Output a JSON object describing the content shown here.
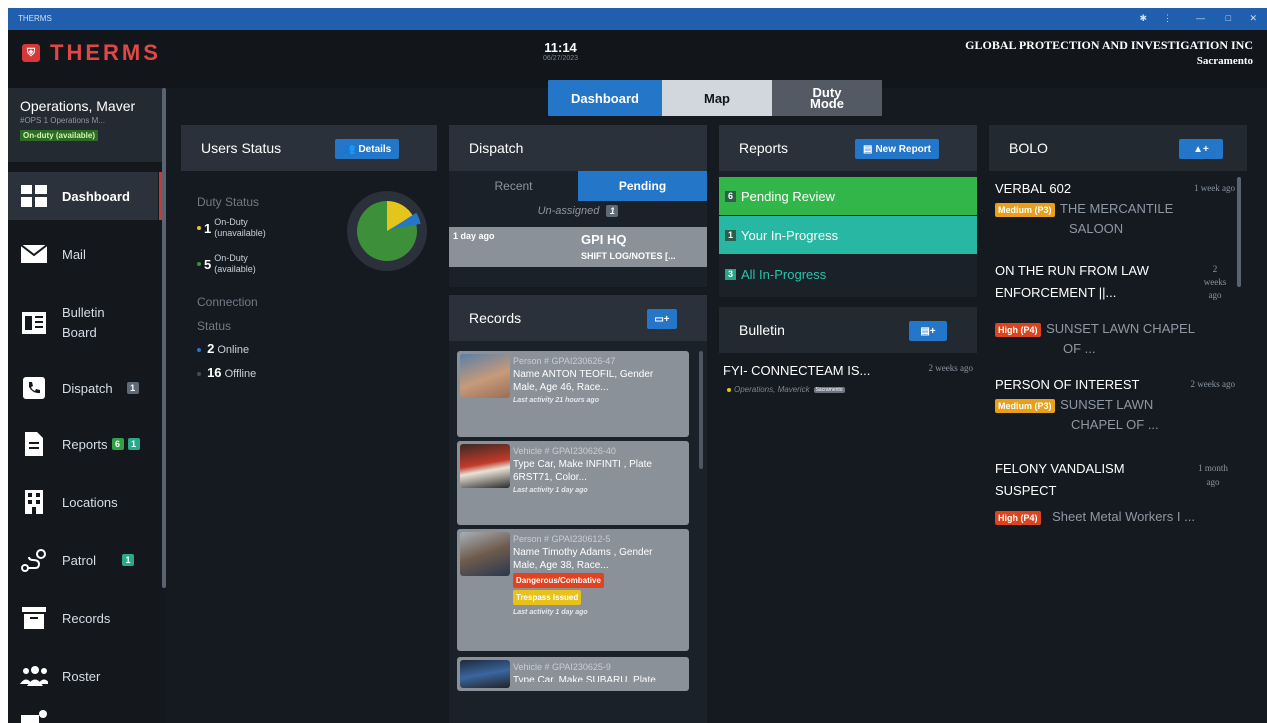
{
  "window": {
    "title": "THERMS"
  },
  "header": {
    "logo_text": "THERMS",
    "time": "11:14",
    "date": "06/27/2023",
    "company": "GLOBAL PROTECTION AND INVESTIGATION INC",
    "city": "Sacramento"
  },
  "profile": {
    "name": "Operations, Maver",
    "role": "#OPS 1 Operations M...",
    "status": "On-duty (available)"
  },
  "nav": [
    {
      "label": "Dashboard",
      "icon": "dashboard-icon"
    },
    {
      "label": "Mail",
      "icon": "mail-icon"
    },
    {
      "label": "Bulletin Board",
      "icon": "bulletin-board-icon"
    },
    {
      "label": "Dispatch",
      "icon": "dispatch-icon",
      "badge": "1"
    },
    {
      "label": "Reports",
      "icon": "reports-icon",
      "badge1": "6",
      "badge2": "1"
    },
    {
      "label": "Locations",
      "icon": "locations-icon"
    },
    {
      "label": "Patrol",
      "icon": "patrol-icon",
      "badge": "1"
    },
    {
      "label": "Records",
      "icon": "records-icon"
    },
    {
      "label": "Roster",
      "icon": "roster-icon"
    }
  ],
  "segments": {
    "dashboard": "Dashboard",
    "map": "Map",
    "duty1": "Duty",
    "duty2": "Mode"
  },
  "users_status": {
    "title": "Users Status",
    "details_button": "Details",
    "duty_status_label": "Duty Status",
    "on_duty_unavail_count": "1",
    "on_duty_unavail_l1": "On-Duty",
    "on_duty_unavail_l2": "(unavailable)",
    "on_duty_avail_count": "5",
    "on_duty_avail_l1": "On-Duty",
    "on_duty_avail_l2": "(available)",
    "connection_l1": "Connection",
    "connection_l2": "Status",
    "online_count": "2",
    "online_label": "Online",
    "offline_count": "16",
    "offline_label": "Offline",
    "pie": {
      "available_fraction": 0.833,
      "unavailable_fraction": 0.167,
      "available_color": "#3d8f3a",
      "unavailable_color": "#e3c51e",
      "segment_color": "#2476c8"
    }
  },
  "dispatch": {
    "title": "Dispatch",
    "tab_recent": "Recent",
    "tab_pending": "Pending",
    "unassigned": "Un-assigned",
    "unassigned_count": "1",
    "card_time": "1 day ago",
    "card_title": "GPI HQ",
    "card_sub": "SHIFT LOG/NOTES [..."
  },
  "records": {
    "title": "Records",
    "items": [
      {
        "id": "Person # GPAI230626-47",
        "l1": "Name ANTON TEOFIL, Gender",
        "l2": "Male, Age 46, Race...",
        "act": "Last activity 21 hours ago"
      },
      {
        "id": "Vehicle # GPAI230626-40",
        "l1": "Type Car, Make INFINTI , Plate",
        "l2": "6RST71, Color...",
        "act": "Last activity 1 day ago"
      },
      {
        "id": "Person # GPAI230612-5",
        "l1": "Name Timothy Adams , Gender",
        "l2": "Male, Age 38, Race...",
        "tag1": "Dangerous/Combative",
        "tag2": "Trespass Issued",
        "act": "Last activity 1 day ago"
      },
      {
        "id": "Vehicle # GPAI230625-9",
        "l1": "Type Car, Make SUBARU, Plate"
      }
    ]
  },
  "reports": {
    "title": "Reports",
    "new_button": "New Report",
    "pending_count": "6",
    "pending_label": "Pending Review",
    "your_count": "1",
    "your_label": "Your In-Progress",
    "all_count": "3",
    "all_label": "All In-Progress"
  },
  "bulletin": {
    "title": "Bulletin",
    "item_title": "FYI- CONNECTEAM IS...",
    "item_time": "2 weeks ago",
    "item_author": "Operations, Maverick",
    "item_tag": "Sacramento"
  },
  "bolo": {
    "title": "BOLO",
    "items": [
      {
        "title": "VERBAL 602",
        "time": "1 week ago",
        "priority": "Medium (P3)",
        "desc1": "THE MERCANTILE",
        "desc2": "SALOON"
      },
      {
        "title1": "ON THE RUN FROM LAW",
        "title2": "ENFORCEMENT ||...",
        "time1": "2",
        "time2": "weeks",
        "time3": "ago",
        "priority": "High (P4)",
        "desc1": "SUNSET LAWN CHAPEL",
        "desc2": "OF ..."
      },
      {
        "title": "PERSON OF INTEREST",
        "time": "2 weeks ago",
        "priority": "Medium (P3)",
        "desc1": "SUNSET LAWN",
        "desc2": "CHAPEL OF ..."
      },
      {
        "title1": "FELONY VANDALISM",
        "title2": "SUSPECT",
        "time1": "1 month",
        "time2": "ago",
        "priority": "High (P4)",
        "desc1": "Sheet Metal Workers I ..."
      }
    ]
  },
  "colors": {
    "accent": "#2476c8",
    "brand": "#e04848",
    "medium": "#e8a01a",
    "high": "#d8451e",
    "pending": "#33b649",
    "inprogress": "#27b7a2"
  }
}
